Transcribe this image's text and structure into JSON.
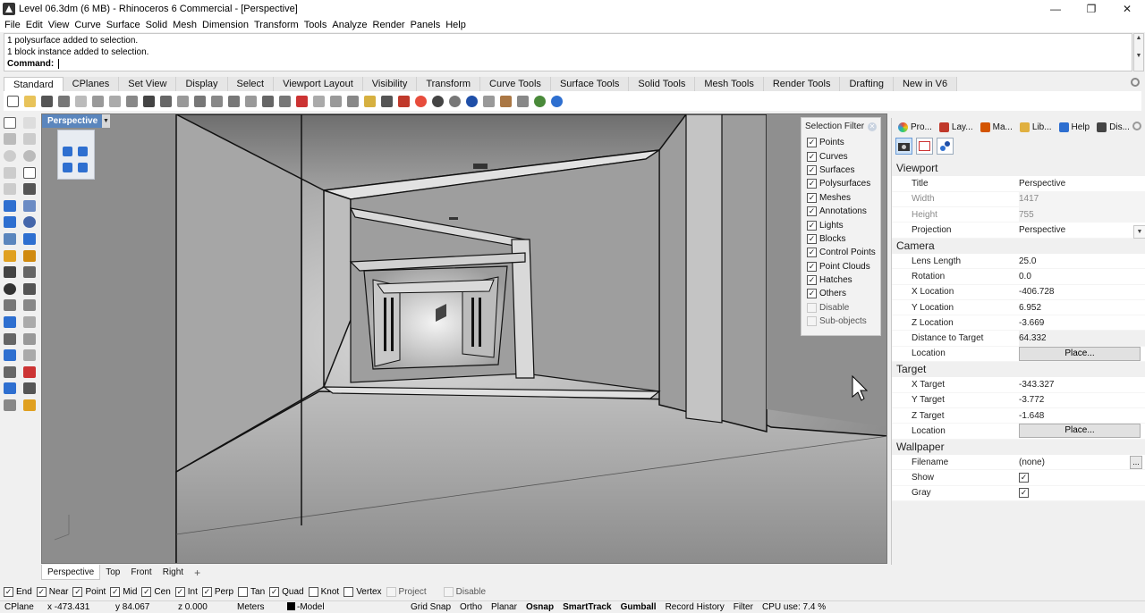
{
  "window": {
    "title": "Level 06.3dm (6 MB) - Rhinoceros 6 Commercial - [Perspective]",
    "minimize": "—",
    "maximize": "❐",
    "close": "✕"
  },
  "menu": [
    "File",
    "Edit",
    "View",
    "Curve",
    "Surface",
    "Solid",
    "Mesh",
    "Dimension",
    "Transform",
    "Tools",
    "Analyze",
    "Render",
    "Panels",
    "Help"
  ],
  "command": {
    "history": [
      "1 polysurface added to selection.",
      "1 block instance added to selection."
    ],
    "prompt": "Command:",
    "value": ""
  },
  "toolbar_tabs": [
    "Standard",
    "CPlanes",
    "Set View",
    "Display",
    "Select",
    "Viewport Layout",
    "Visibility",
    "Transform",
    "Curve Tools",
    "Surface Tools",
    "Solid Tools",
    "Mesh Tools",
    "Render Tools",
    "Drafting",
    "New in V6"
  ],
  "viewport": {
    "label": "Perspective"
  },
  "selection_filter": {
    "title": "Selection Filter",
    "items": [
      {
        "label": "Points",
        "checked": true
      },
      {
        "label": "Curves",
        "checked": true
      },
      {
        "label": "Surfaces",
        "checked": true
      },
      {
        "label": "Polysurfaces",
        "checked": true
      },
      {
        "label": "Meshes",
        "checked": true
      },
      {
        "label": "Annotations",
        "checked": true
      },
      {
        "label": "Lights",
        "checked": true
      },
      {
        "label": "Blocks",
        "checked": true
      },
      {
        "label": "Control Points",
        "checked": true
      },
      {
        "label": "Point Clouds",
        "checked": true
      },
      {
        "label": "Hatches",
        "checked": true
      },
      {
        "label": "Others",
        "checked": true
      },
      {
        "label": "Disable",
        "checked": false
      },
      {
        "label": "Sub-objects",
        "checked": false
      }
    ]
  },
  "panel_tabs": [
    "Pro...",
    "Lay...",
    "Ma...",
    "Lib...",
    "Help",
    "Dis..."
  ],
  "properties": {
    "viewport": {
      "title": "Viewport",
      "title_label": "Title",
      "title_value": "Perspective",
      "width_label": "Width",
      "width_value": "1417",
      "height_label": "Height",
      "height_value": "755",
      "projection_label": "Projection",
      "projection_value": "Perspective"
    },
    "camera": {
      "title": "Camera",
      "lens_label": "Lens Length",
      "lens_value": "25.0",
      "rotation_label": "Rotation",
      "rotation_value": "0.0",
      "xloc_label": "X Location",
      "xloc_value": "-406.728",
      "yloc_label": "Y Location",
      "yloc_value": "6.952",
      "zloc_label": "Z Location",
      "zloc_value": "-3.669",
      "dist_label": "Distance to Target",
      "dist_value": "64.332",
      "loc_label": "Location",
      "loc_button": "Place..."
    },
    "target": {
      "title": "Target",
      "xt_label": "X Target",
      "xt_value": "-343.327",
      "yt_label": "Y Target",
      "yt_value": "-3.772",
      "zt_label": "Z Target",
      "zt_value": "-1.648",
      "loc_label": "Location",
      "loc_button": "Place..."
    },
    "wallpaper": {
      "title": "Wallpaper",
      "file_label": "Filename",
      "file_value": "(none)",
      "file_button": "...",
      "show_label": "Show",
      "show_checked": true,
      "gray_label": "Gray",
      "gray_checked": true
    }
  },
  "viewport_tabs": [
    "Perspective",
    "Top",
    "Front",
    "Right"
  ],
  "viewport_add": "+",
  "osnaps": [
    {
      "label": "End",
      "checked": true
    },
    {
      "label": "Near",
      "checked": true
    },
    {
      "label": "Point",
      "checked": true
    },
    {
      "label": "Mid",
      "checked": true
    },
    {
      "label": "Cen",
      "checked": true
    },
    {
      "label": "Int",
      "checked": true
    },
    {
      "label": "Perp",
      "checked": true
    },
    {
      "label": "Tan",
      "checked": false
    },
    {
      "label": "Quad",
      "checked": true
    },
    {
      "label": "Knot",
      "checked": false
    },
    {
      "label": "Vertex",
      "checked": false
    },
    {
      "label": "Project",
      "checked": false,
      "disabled": true
    },
    {
      "label": "Disable",
      "checked": false,
      "disabled": true
    }
  ],
  "status": {
    "cplane": "CPlane",
    "x": "x -473.431",
    "y": "y 84.067",
    "z": "z 0.000",
    "units": "Meters",
    "layer": "-Model",
    "grid_snap": "Grid Snap",
    "ortho": "Ortho",
    "planar": "Planar",
    "osnap": "Osnap",
    "smarttrack": "SmartTrack",
    "gumball": "Gumball",
    "record_history": "Record History",
    "filter": "Filter",
    "cpu": "CPU use: 7.4 %"
  },
  "colors": {
    "viewport_label_bg": "#5b86bd",
    "accent_blue": "#2e6fd0"
  }
}
